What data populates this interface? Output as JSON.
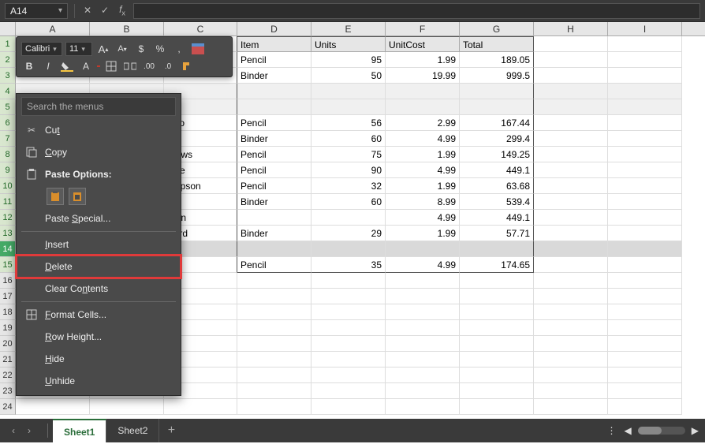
{
  "name_box": "A14",
  "col_widths": {
    "A": 94,
    "B": 94,
    "C": 93,
    "D": 94,
    "E": 94,
    "F": 94,
    "G": 94,
    "H": 94,
    "I": 94
  },
  "columns": [
    "A",
    "B",
    "C",
    "D",
    "E",
    "F",
    "G",
    "H",
    "I"
  ],
  "row_start": 1,
  "visible_rows": 24,
  "headers_row": 1,
  "headers": {
    "D": "Item",
    "E": "Units",
    "F": "UnitCost",
    "G": "Total"
  },
  "data_rows": [
    {
      "r": 2,
      "C": "",
      "D": "Pencil",
      "E": "95",
      "F": "1.99",
      "G": "189.05"
    },
    {
      "r": 3,
      "C": "",
      "D": "Binder",
      "E": "50",
      "F": "19.99",
      "G": "999.5"
    },
    {
      "r": 4,
      "blank": true
    },
    {
      "r": 5,
      "blank": true
    },
    {
      "r": 6,
      "C": "vino",
      "D": "Pencil",
      "E": "56",
      "F": "2.99",
      "G": "167.44"
    },
    {
      "r": 7,
      "C": "es",
      "D": "Binder",
      "E": "60",
      "F": "4.99",
      "G": "299.4"
    },
    {
      "r": 8,
      "C": "drews",
      "D": "Pencil",
      "E": "75",
      "F": "1.99",
      "G": "149.25"
    },
    {
      "r": 9,
      "C": "dine",
      "D": "Pencil",
      "E": "90",
      "F": "4.99",
      "G": "449.1"
    },
    {
      "r": 10,
      "C": "ompson",
      "D": "Pencil",
      "E": "32",
      "F": "1.99",
      "G": "63.68"
    },
    {
      "r": 11,
      "C": "es",
      "D": "Binder",
      "E": "60",
      "F": "8.99",
      "G": "539.4"
    },
    {
      "r": 12,
      "C": "rgan",
      "D": "",
      "E": "",
      "F": "4.99",
      "G": "449.1"
    },
    {
      "r": 13,
      "C": "ward",
      "D": "Binder",
      "E": "29",
      "F": "1.99",
      "G": "57.71"
    },
    {
      "r": 14,
      "selected": true
    },
    {
      "r": 15,
      "C": "es",
      "D": "Pencil",
      "E": "35",
      "F": "4.99",
      "G": "174.65",
      "last": true
    }
  ],
  "mini_toolbar": {
    "font": "Calibri",
    "size": "11"
  },
  "ctx": {
    "search_placeholder": "Search the menus",
    "cut": "Cut",
    "copy": "Copy",
    "paste_options": "Paste Options:",
    "paste_special": "Paste Special...",
    "insert": "Insert",
    "delete": "Delete",
    "clear_contents": "Clear Contents",
    "format_cells": "Format Cells...",
    "row_height": "Row Height...",
    "hide": "Hide",
    "unhide": "Unhide"
  },
  "tabs": {
    "active": "Sheet1",
    "other": "Sheet2"
  }
}
